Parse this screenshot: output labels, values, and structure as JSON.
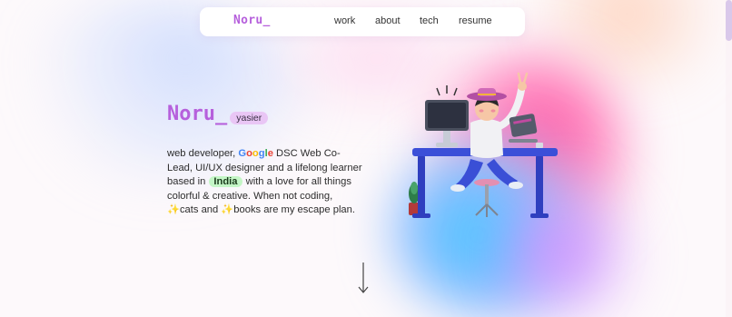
{
  "nav": {
    "logo": "Noru_",
    "links": [
      {
        "label": "work"
      },
      {
        "label": "about"
      },
      {
        "label": "tech"
      },
      {
        "label": "resume"
      }
    ]
  },
  "hero": {
    "title": "Noru_",
    "badge": "yasier",
    "bio": {
      "p1": "web developer, ",
      "google": [
        "G",
        "o",
        "o",
        "g",
        "l",
        "e"
      ],
      "p2": " DSC Web Co-Lead, UI/UX designer and a lifelong learner based in ",
      "india": "India",
      "p3": " with a love for all things colorful & creative. When not coding, ",
      "sparkle": "✨",
      "p4": "cats and ",
      "p5": "books are my escape plan."
    }
  },
  "colors": {
    "accent": "#b660dc",
    "google_letters": [
      "#4285F4",
      "#EA4335",
      "#FBBC05",
      "#4285F4",
      "#34A853",
      "#EA4335"
    ]
  },
  "icons": {
    "scroll_arrow": "arrow-down-icon",
    "illustration": "developer-at-desk-illustration"
  }
}
